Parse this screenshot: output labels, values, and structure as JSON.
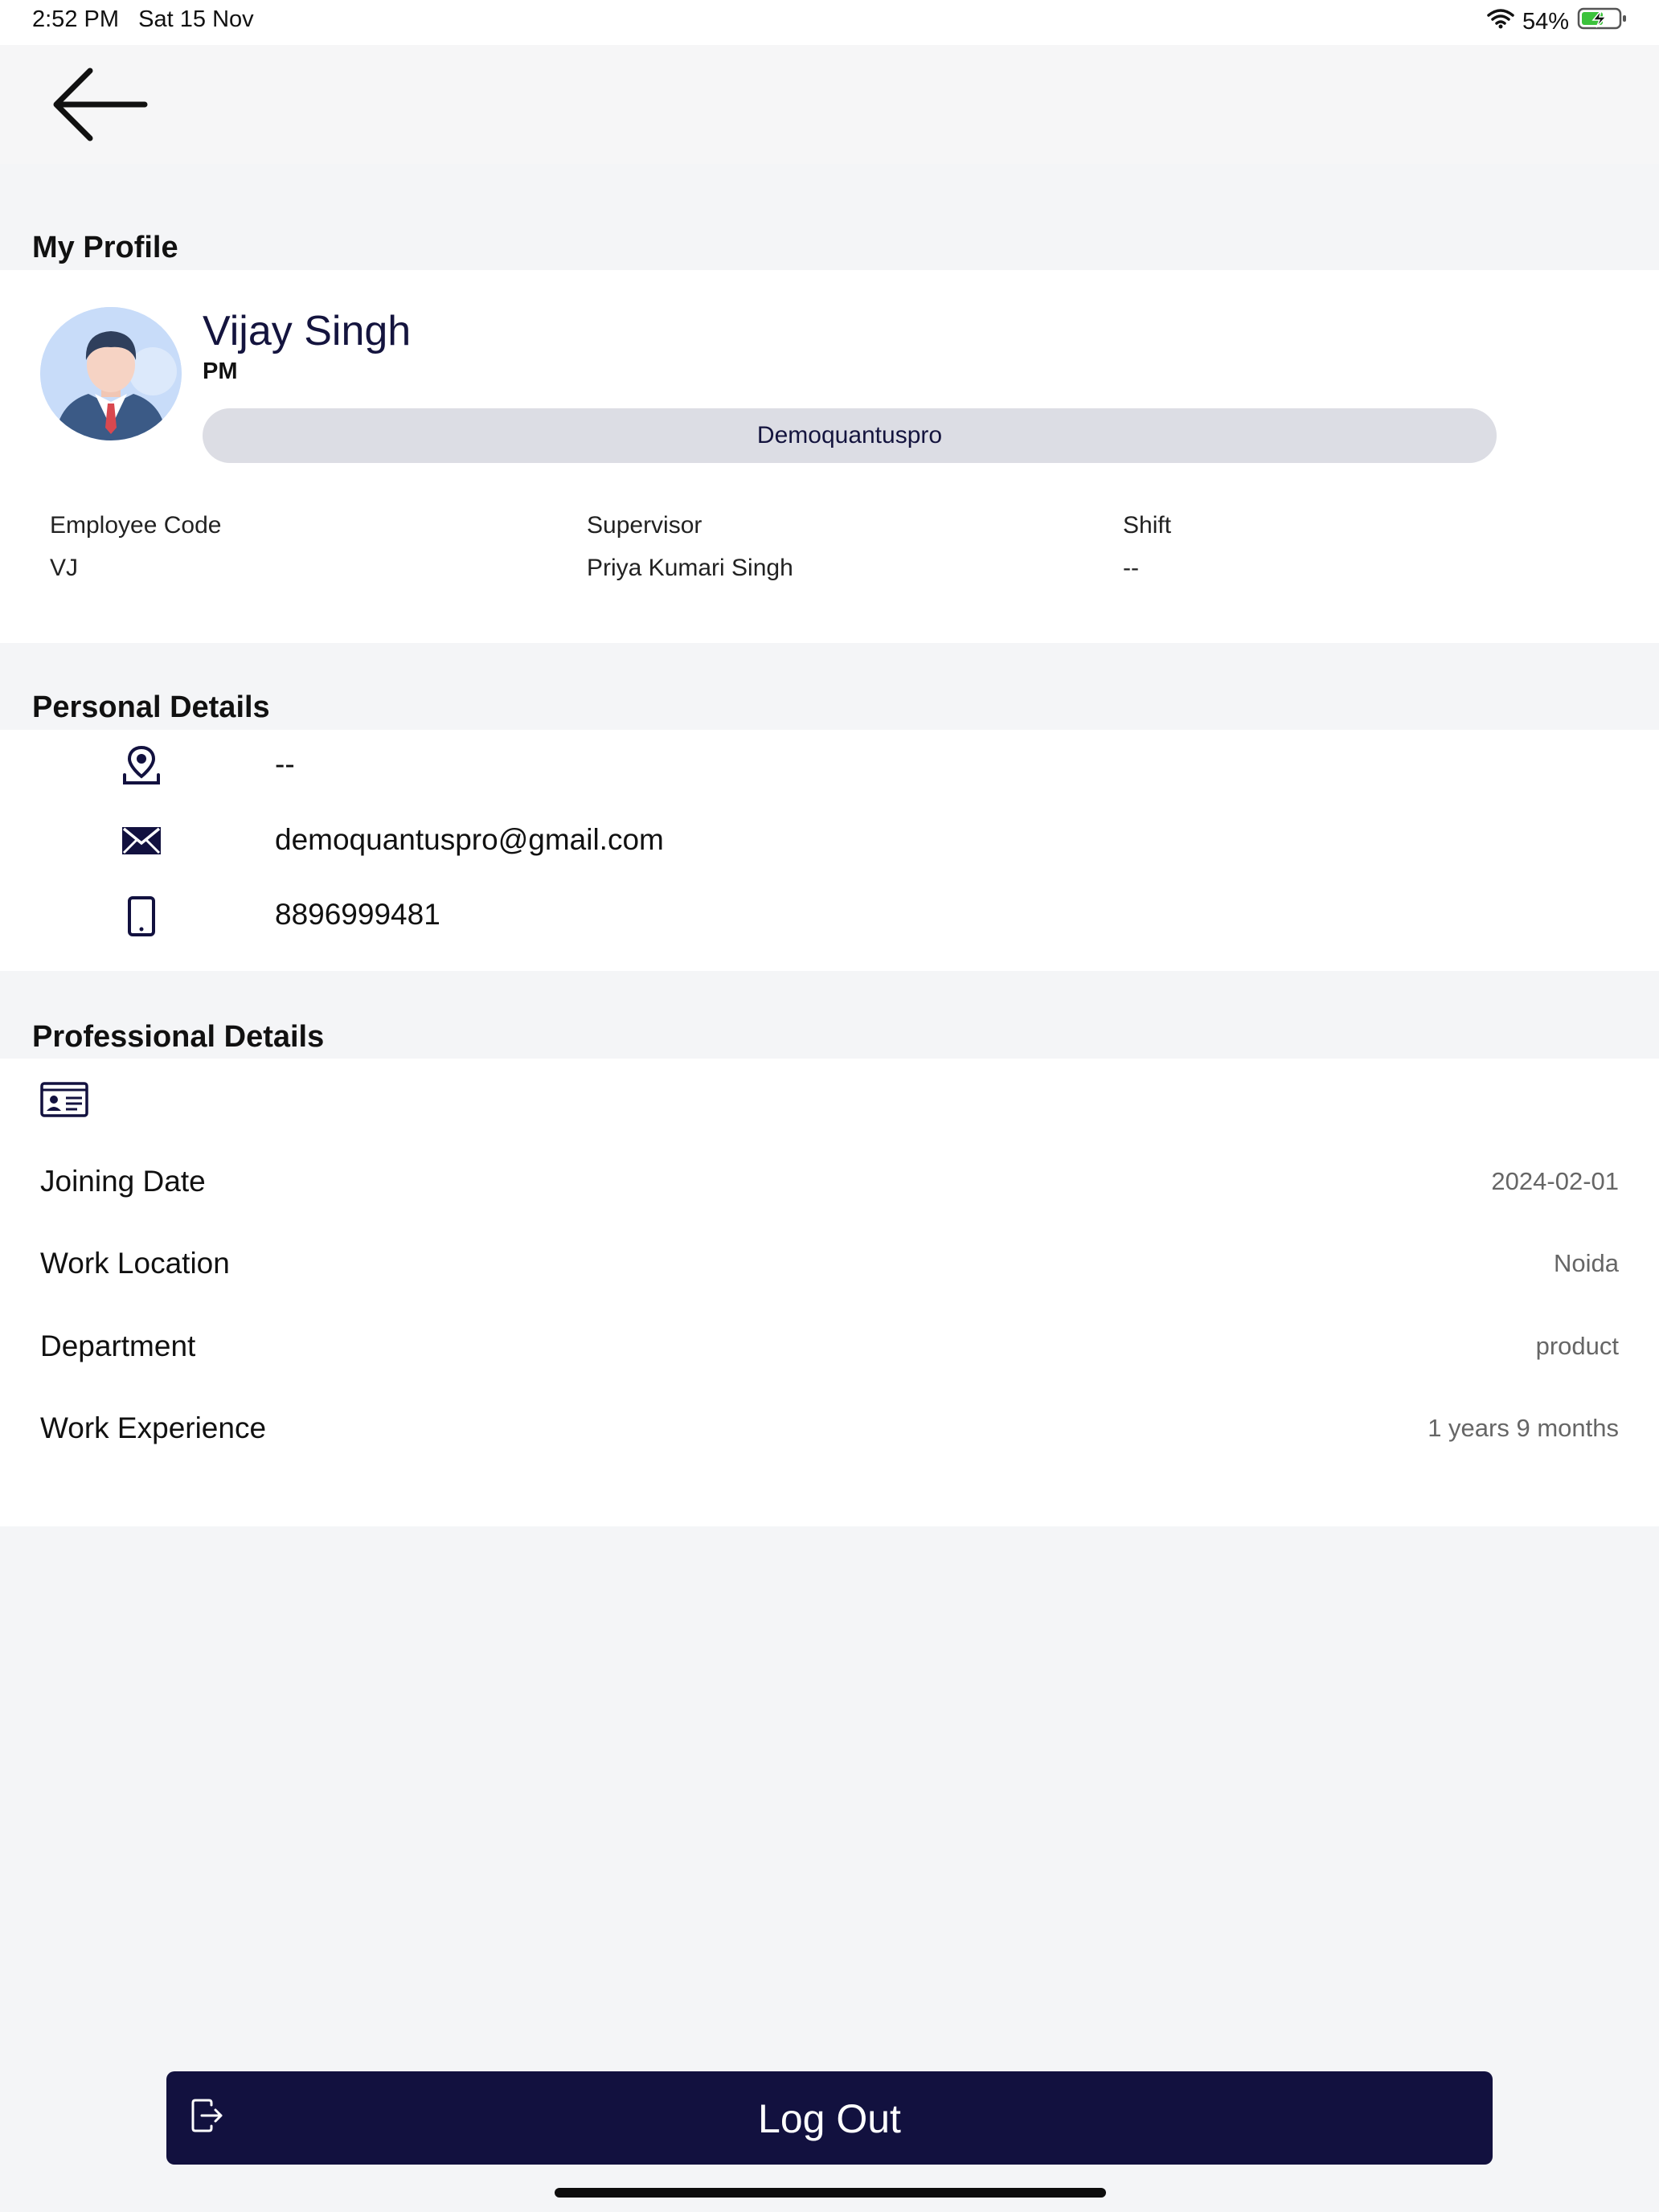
{
  "status_bar": {
    "time": "2:52 PM",
    "date": "Sat 15 Nov",
    "battery": "54%"
  },
  "profile": {
    "section_title": "My Profile",
    "name": "Vijay Singh",
    "role": "PM",
    "company": "Demoquantuspro",
    "fields": [
      {
        "label": "Employee Code",
        "value": "VJ"
      },
      {
        "label": "Supervisor",
        "value": "Priya Kumari Singh"
      },
      {
        "label": "Shift",
        "value": "--"
      }
    ]
  },
  "personal": {
    "section_title": "Personal Details",
    "address": "--",
    "email": "demoquantuspro@gmail.com",
    "phone": "8896999481"
  },
  "professional": {
    "section_title": "Professional Details",
    "rows": [
      {
        "label": "Joining Date",
        "value": "2024-02-01"
      },
      {
        "label": "Work Location",
        "value": "Noida"
      },
      {
        "label": "Department",
        "value": "product"
      },
      {
        "label": "Work Experience",
        "value": "1 years 9 months"
      }
    ]
  },
  "logout": {
    "label": "Log Out"
  },
  "colors": {
    "primary": "#12113f",
    "pill": "#dcdde4",
    "background": "#f4f5f7"
  }
}
